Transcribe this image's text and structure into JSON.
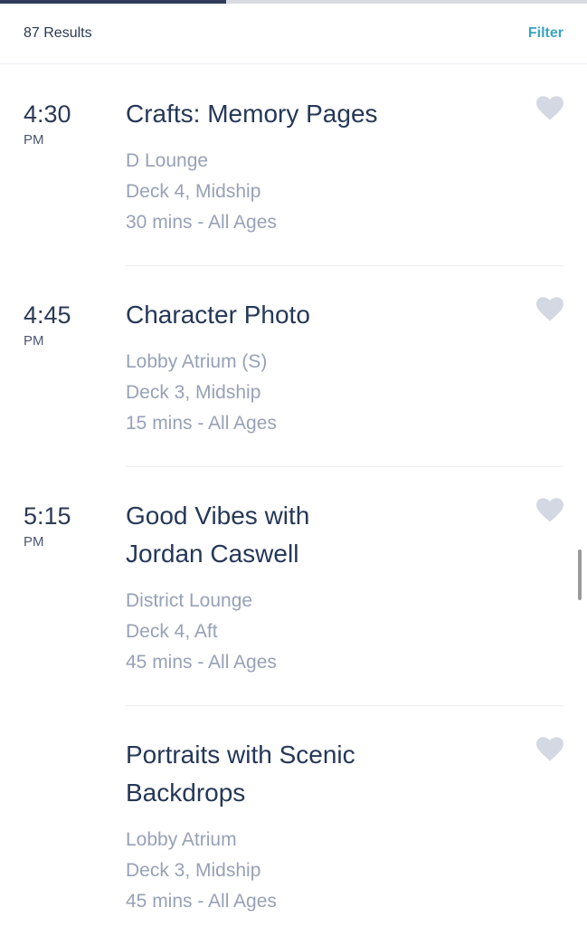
{
  "progress": {
    "fraction": 0.385,
    "fill_color": "#2f3d58",
    "track_color": "#d9dce3"
  },
  "header": {
    "results_label": "87 Results",
    "filter_label": "Filter",
    "accent_color": "#3aa3c3"
  },
  "events": [
    {
      "time": "4:30",
      "ampm": "PM",
      "title": "Crafts: Memory Pages",
      "location": "D Lounge",
      "deck": "Deck 4, Midship",
      "details": "30 mins - All Ages",
      "favorite_icon": "heart-icon",
      "favorited": false
    },
    {
      "time": "4:45",
      "ampm": "PM",
      "title": "Character Photo",
      "location": "Lobby Atrium (S)",
      "deck": "Deck 3, Midship",
      "details": "15 mins - All Ages",
      "favorite_icon": "heart-icon",
      "favorited": false
    },
    {
      "time": "5:15",
      "ampm": "PM",
      "title": "Good Vibes with Jordan Caswell",
      "location": "District Lounge",
      "deck": "Deck 4, Aft",
      "details": "45 mins - All Ages",
      "favorite_icon": "heart-icon",
      "favorited": false
    },
    {
      "time": "",
      "ampm": "",
      "title": "Portraits with Scenic Backdrops",
      "location": "Lobby Atrium",
      "deck": "Deck 3, Midship",
      "details": "45 mins - All Ages",
      "favorite_icon": "heart-icon",
      "favorited": false
    }
  ]
}
